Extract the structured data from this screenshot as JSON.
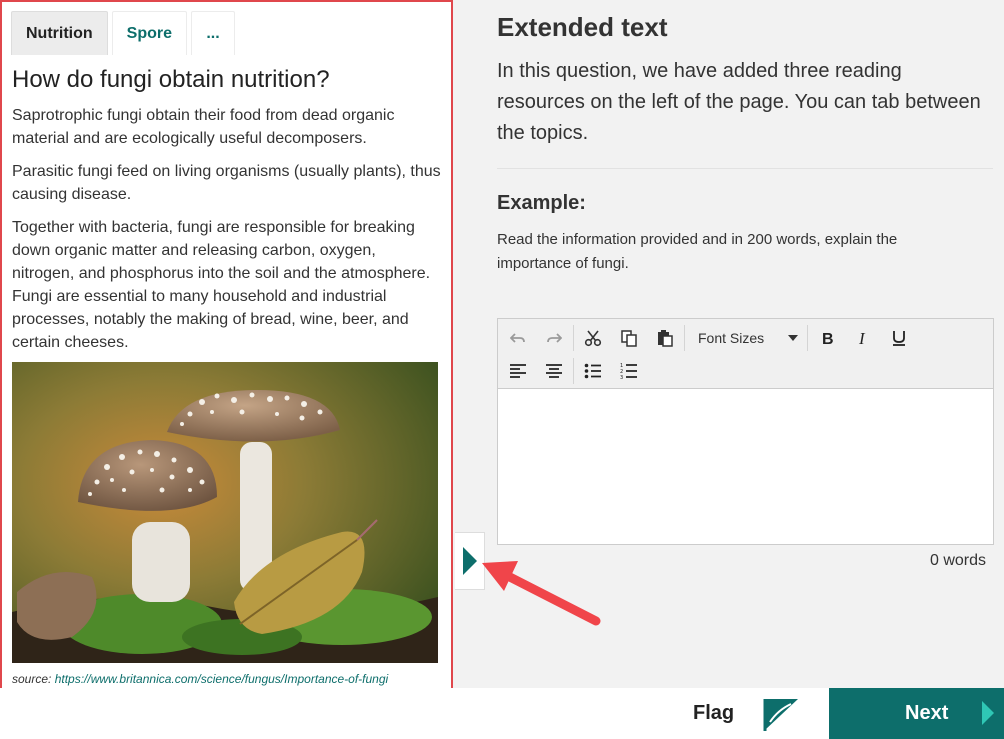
{
  "resource_panel": {
    "tabs": [
      {
        "label": "Nutrition",
        "active": true
      },
      {
        "label": "Spore",
        "active": false
      },
      {
        "label": "...",
        "active": false
      }
    ],
    "title": "How do fungi obtain nutrition?",
    "paragraphs": [
      "Saprotrophic fungi obtain their food from dead organic material and are ecologically useful decomposers.",
      "Parasitic fungi feed on living organisms (usually plants), thus causing disease.",
      "Together with bacteria, fungi are responsible for breaking down organic matter and releasing carbon, oxygen, nitrogen, and phosphorus into the soil and the atmosphere. Fungi are essential to many household and industrial processes, notably the making of bread, wine, beer, and certain cheeses."
    ],
    "image_alt": "mushrooms",
    "source_label": "source:",
    "source_link": "https://www.britannica.com/science/fungus/Importance-of-fungi"
  },
  "question": {
    "title": "Extended text",
    "intro": "In this question, we have added three reading resources on the left of the page. You can tab between the topics.",
    "example_label": "Example:",
    "example_text": "Read the information provided and in 200 words, explain the importance of fungi."
  },
  "editor": {
    "font_sizes_label": "Font Sizes",
    "word_count": "0 words",
    "toolbar_icons": [
      "undo-icon",
      "redo-icon",
      "cut-icon",
      "copy-icon",
      "paste-icon",
      "bold-icon",
      "italic-icon",
      "underline-icon",
      "align-left-icon",
      "align-center-icon",
      "bullet-list-icon",
      "numbered-list-icon"
    ]
  },
  "footer": {
    "flag_label": "Flag",
    "next_label": "Next"
  },
  "colors": {
    "accent": "#0d6e6b",
    "panel_border": "#e0474c",
    "arrow": "#f0454a",
    "background": "#f2f2f2"
  }
}
